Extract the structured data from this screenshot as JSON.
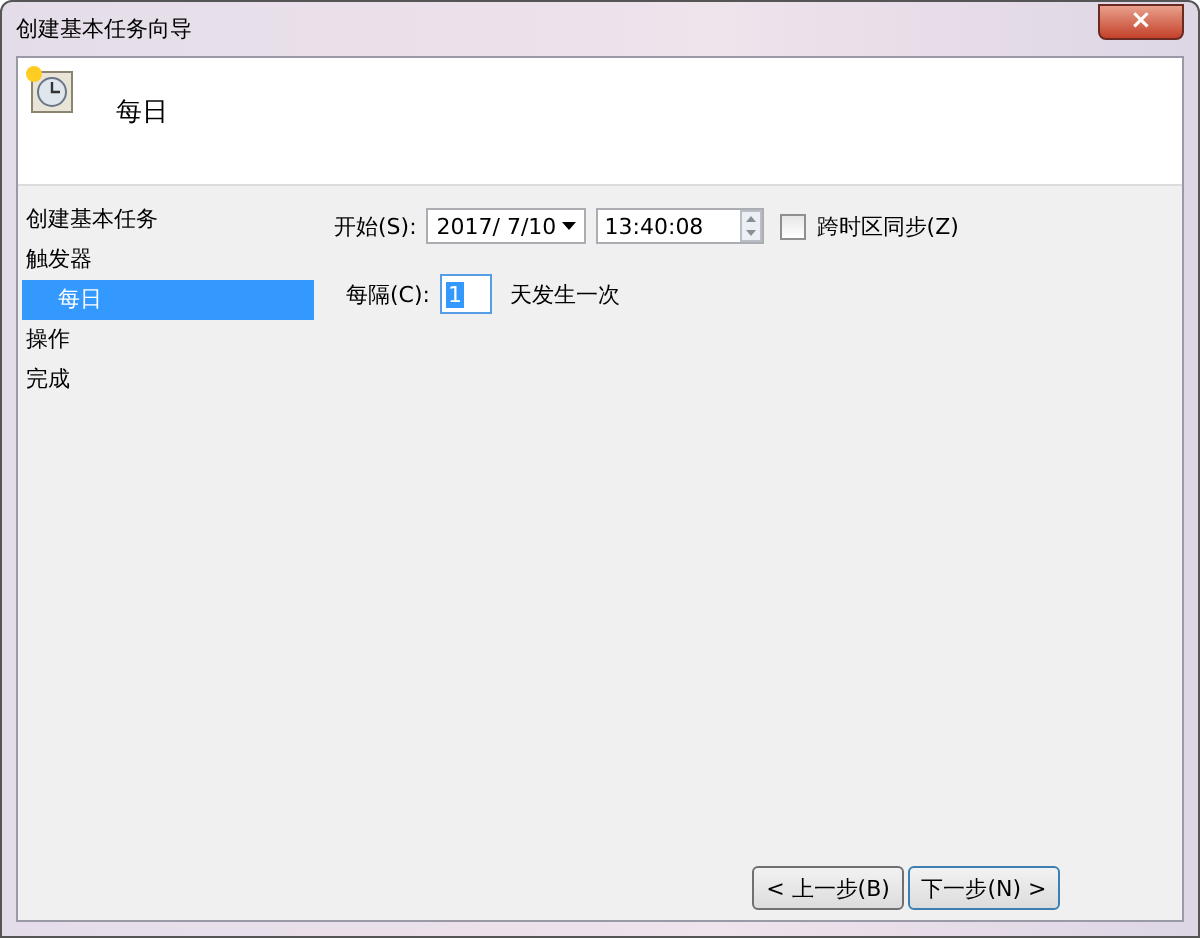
{
  "window": {
    "title": "创建基本任务向导",
    "close": "×"
  },
  "header": {
    "title": "每日"
  },
  "sidebar": {
    "items": [
      {
        "label": "创建基本任务",
        "selected": false
      },
      {
        "label": "触发器",
        "selected": false,
        "children": [
          {
            "label": "每日",
            "selected": true
          }
        ]
      },
      {
        "label": "操作",
        "selected": false
      },
      {
        "label": "完成",
        "selected": false
      }
    ]
  },
  "start": {
    "label": "开始(S):",
    "date": "2017/  7/10",
    "time": "13:40:08",
    "sync": {
      "label": "跨时区同步(Z)",
      "checked": false
    }
  },
  "recur": {
    "label": "每隔(C):",
    "value": "1",
    "suffix": "天发生一次"
  },
  "buttons": [
    {
      "label": "< 上一步(B)",
      "kind": "normal"
    },
    {
      "label": "下一步(N) >",
      "kind": "default"
    }
  ]
}
